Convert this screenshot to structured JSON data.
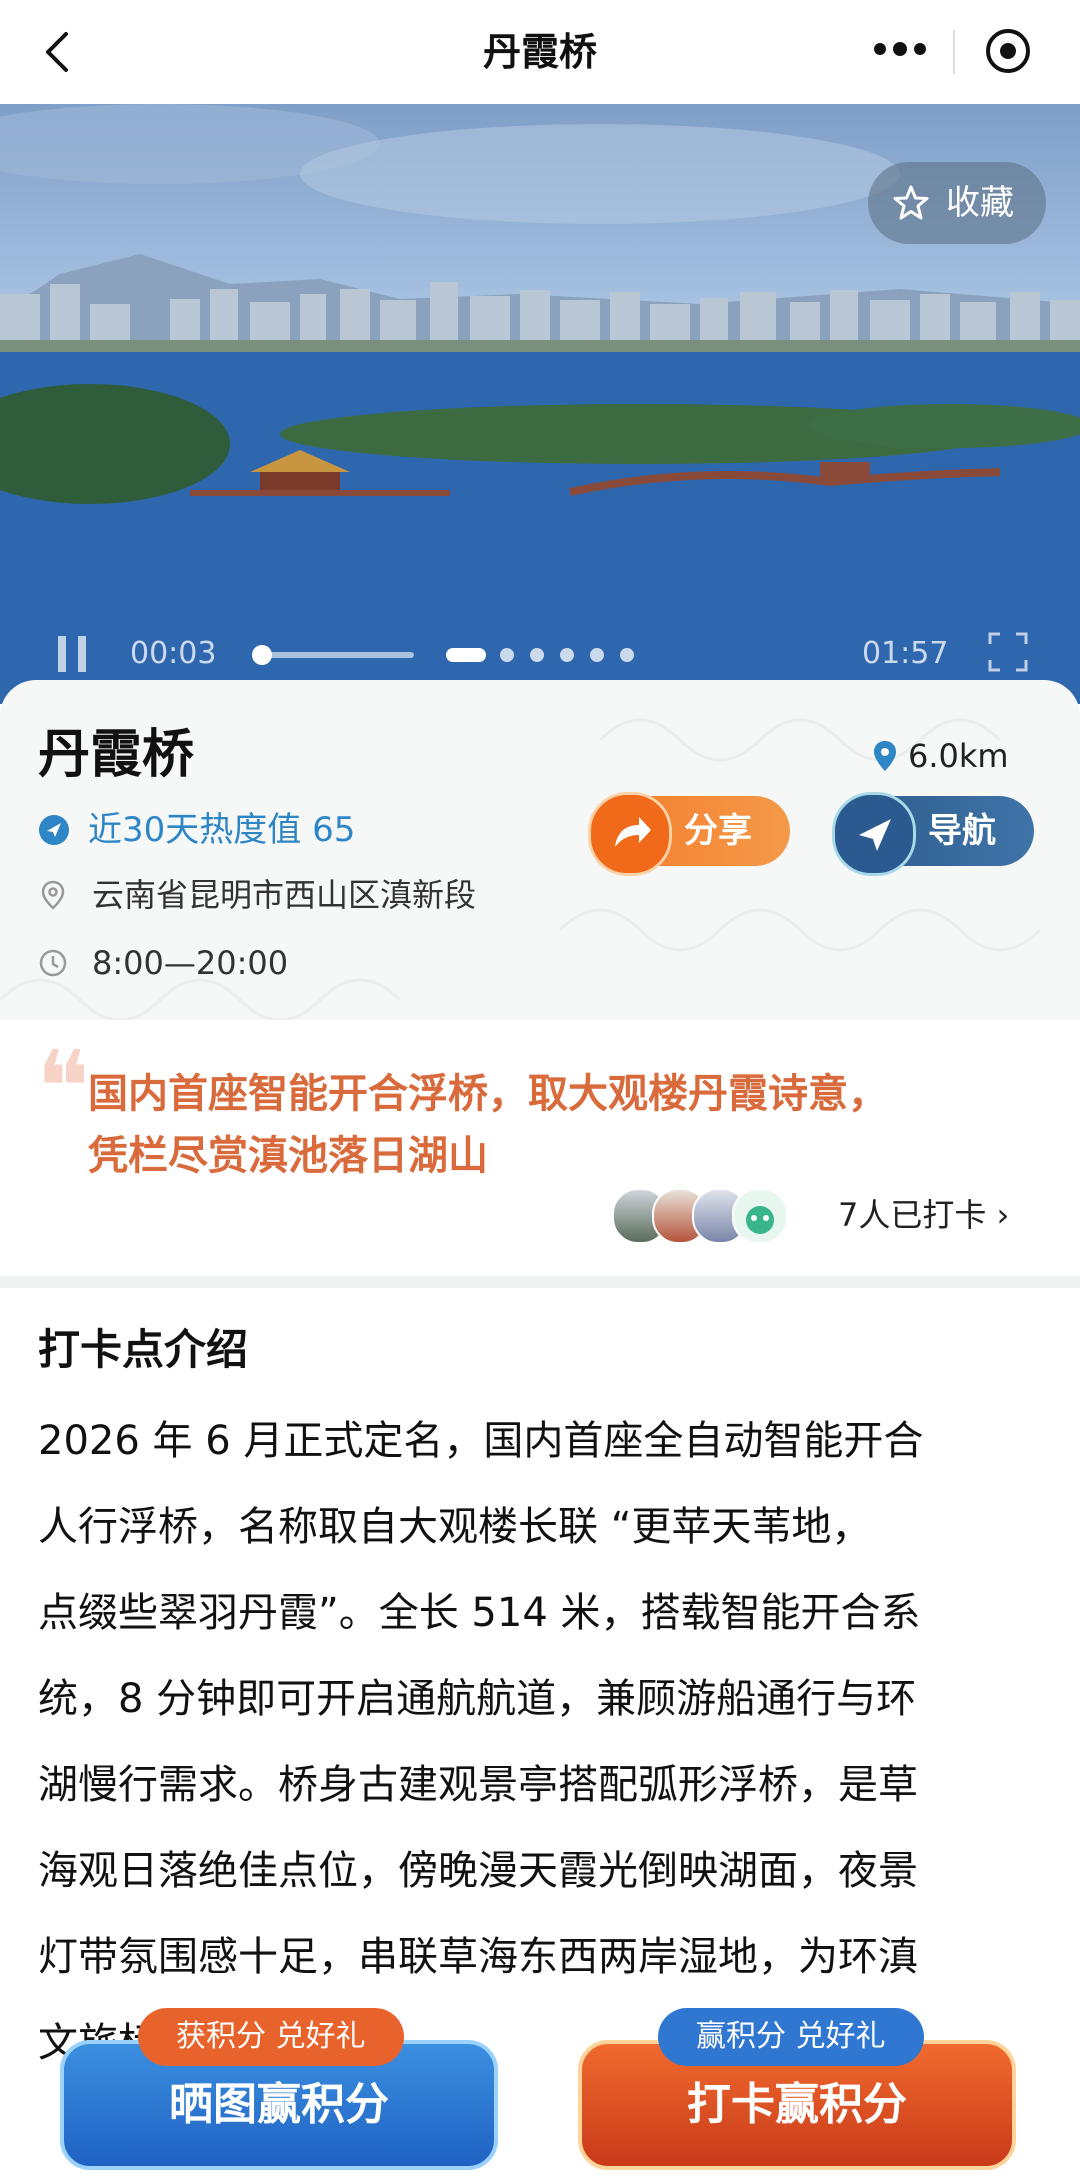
{
  "nav": {
    "title": "丹霞桥"
  },
  "hero": {
    "favorite_label": "收藏",
    "time_current": "00:03",
    "time_total": "01:57",
    "progress": 0.03,
    "slide_count": 6,
    "slide_active": 0
  },
  "info": {
    "name": "丹霞桥",
    "distance": "6.0km",
    "heat": "近30天热度值 65",
    "share_label": "分享",
    "nav_label": "导航",
    "address": "云南省昆明市西山区滇新段",
    "hours": "8:00—20:00"
  },
  "quote": {
    "line1": "国内首座智能开合浮桥，取大观楼丹霞诗意，",
    "line2": "凭栏尽赏滇池落日湖山",
    "checkin": "7人已打卡 ›"
  },
  "intro": {
    "title": "打卡点介绍",
    "lines": [
      "2026 年 6 月正式定名，国内首座全自动智能开合",
      "人行浮桥，名称取自大观楼长联 “更苹天苇地，",
      "点缀些翠羽丹霞”。全长 514 米，搭载智能开合系",
      "统，8 分钟即可开启通航航道，兼顾游船通行与环",
      "湖慢行需求。桥身古建观景亭搭配弧形浮桥，是草",
      "海观日落绝佳点位，傍晚漫天霞光倒映湖面，夜景",
      "灯带氛围感十足，串联草海东西两岸湿地，为环滇",
      "文旅标"
    ]
  },
  "cta": {
    "left_badge": "获积分 兑好礼",
    "left_label": "晒图赢积分",
    "right_badge": "赢积分 兑好礼",
    "right_label": "打卡赢积分"
  }
}
